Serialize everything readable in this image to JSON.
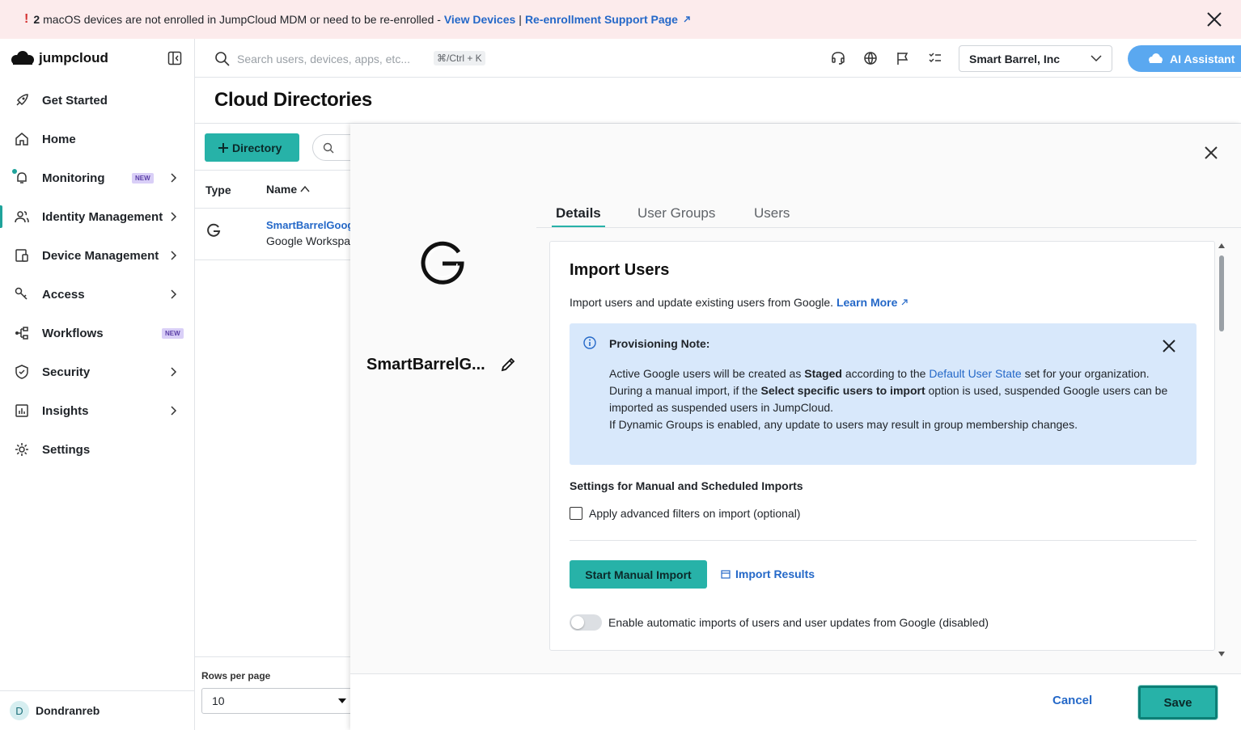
{
  "banner": {
    "count": "2",
    "message": "macOS devices are not enrolled in JumpCloud MDM or need to be re-enrolled -",
    "view_devices": "View Devices",
    "separator": "|",
    "support": "Re-enrollment Support Page"
  },
  "sidebar": {
    "brand": "jumpcloud",
    "items": [
      {
        "label": "Get Started"
      },
      {
        "label": "Home"
      },
      {
        "label": "Monitoring",
        "badge": "NEW"
      },
      {
        "label": "Identity Management"
      },
      {
        "label": "Device Management"
      },
      {
        "label": "Access"
      },
      {
        "label": "Workflows",
        "badge": "NEW"
      },
      {
        "label": "Security"
      },
      {
        "label": "Insights"
      },
      {
        "label": "Settings"
      }
    ],
    "user": {
      "initial": "D",
      "name": "Dondranreb"
    }
  },
  "topbar": {
    "search_placeholder": "Search users, devices, apps, etc...",
    "shortcut": "⌘/Ctrl + K",
    "org_name": "Smart Barrel, Inc",
    "ai_label": "AI Assistant"
  },
  "page": {
    "title": "Cloud Directories",
    "add_button": "Directory",
    "columns": {
      "type": "Type",
      "name": "Name"
    },
    "rows": [
      {
        "name": "SmartBarrelGoogle",
        "type": "Google Workspace"
      }
    ],
    "rows_per_page_label": "Rows per page",
    "rows_per_page": "10"
  },
  "drawer": {
    "directory_name": "SmartBarrelG...",
    "tabs": [
      "Details",
      "User Groups",
      "Users"
    ],
    "card": {
      "title": "Import Users",
      "desc": "Import users and update existing users from Google.",
      "learn_more": "Learn More",
      "note": {
        "title": "Provisioning Note:",
        "p1_a": "Active Google users will be created as",
        "p1_b": "Staged",
        "p1_c": "according to the",
        "p1_link": "Default User State",
        "p1_d": "set for your organization.",
        "p2_a": "During a manual import, if the",
        "p2_b": "Select specific users to import",
        "p2_c": "option is used, suspended Google users can be imported as suspended users in JumpCloud.",
        "p3": "If Dynamic Groups is enabled, any update to users may result in group membership changes."
      },
      "settings_heading": "Settings for Manual and Scheduled Imports",
      "advanced_filters": "Apply advanced filters on import (optional)",
      "start_import": "Start Manual Import",
      "import_results": "Import Results",
      "auto_import": "Enable automatic imports of users and user updates from Google (disabled)"
    },
    "cancel": "Cancel",
    "save": "Save"
  }
}
